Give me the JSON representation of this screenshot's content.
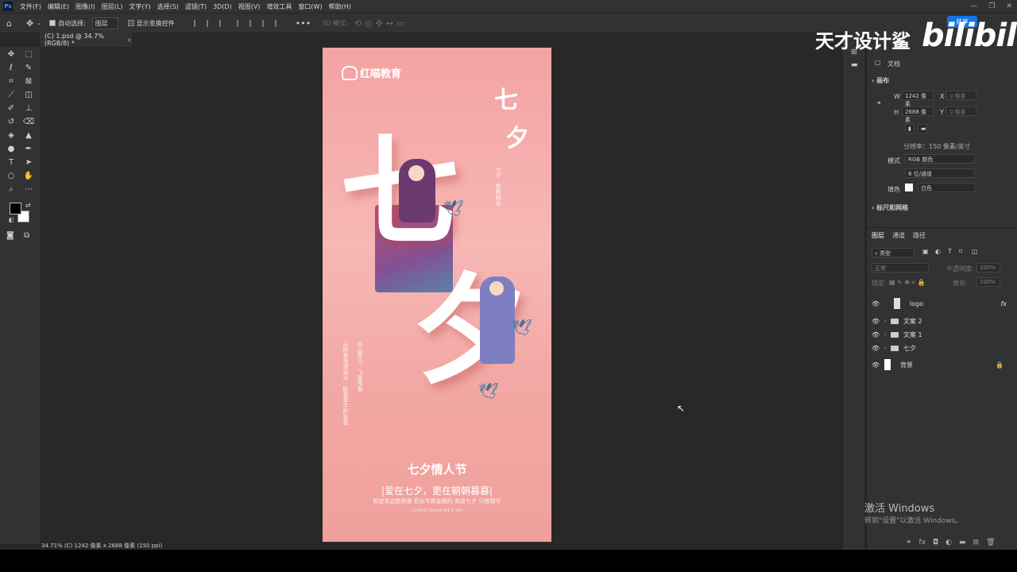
{
  "menu": [
    "文件(F)",
    "编辑(E)",
    "图像(I)",
    "图层(L)",
    "文字(Y)",
    "选择(S)",
    "滤镜(T)",
    "3D(D)",
    "视图(V)",
    "增效工具",
    "窗口(W)",
    "帮助(H)"
  ],
  "options": {
    "auto_select_label": "自动选择:",
    "auto_select_value": "图层",
    "show_transform_label": "显示变换控件",
    "mode_3d_label": "3D 模式:",
    "share_label": "共享"
  },
  "doc_tab": "(C) 1.psd @ 34.7%(RGB/8) *",
  "canvas": {
    "brand": "红喵教育",
    "big_char_1": "七",
    "big_char_2": "夕",
    "small_char_1": "七",
    "small_char_2": "夕",
    "festival": "七夕情人节",
    "slogan": "|爱在七夕，更在朝朝暮暮|",
    "sub_line": "盼定东边鹊桥里 彩女牛郎会相约 和这七夕 只愿相守",
    "tiny_line": "CHINESE VALENTINE'S DAY"
  },
  "status_text": "34.71%  (C) 1242 像素 x 2688 像素 (150 ppi)",
  "properties": {
    "doc_label": "文档",
    "canvas_section": "画布",
    "w_label": "W",
    "w_value": "1242 像素",
    "x_label": "X",
    "x_placeholder": "0 像素",
    "h_label": "H",
    "h_value": "2688 像素",
    "y_label": "Y",
    "y_placeholder": "0 像素",
    "resolution": "分辨率：150 像素/英寸",
    "mode_label": "模式",
    "mode_value": "RGB 颜色",
    "depth_value": "8 位/通道",
    "fill_label": "填色",
    "fill_value": "白色",
    "rulers_section": "标尺和网格"
  },
  "layers_panel": {
    "tabs": [
      "图层",
      "通道",
      "路径"
    ],
    "filter_label": "类型",
    "blend_mode": "正常",
    "opacity_label": "不透明度:",
    "opacity_value": "100%",
    "lock_label": "锁定:",
    "fill_label": "填充:",
    "fill_value": "100%",
    "layers": [
      {
        "name": "logo",
        "fx": "fx"
      },
      {
        "name": "文案 2"
      },
      {
        "name": "文案 1"
      },
      {
        "name": "七夕"
      },
      {
        "name": "背景"
      }
    ]
  },
  "watermark": {
    "text": "天才设计鲨",
    "bili": "bilibili"
  },
  "activate": {
    "line1": "激活 Windows",
    "line2": "转到\"设置\"以激活 Windows。"
  },
  "colors": {
    "accent": "#1473e6",
    "panel": "#323232",
    "canvas_pink": "#f3a3a2"
  }
}
